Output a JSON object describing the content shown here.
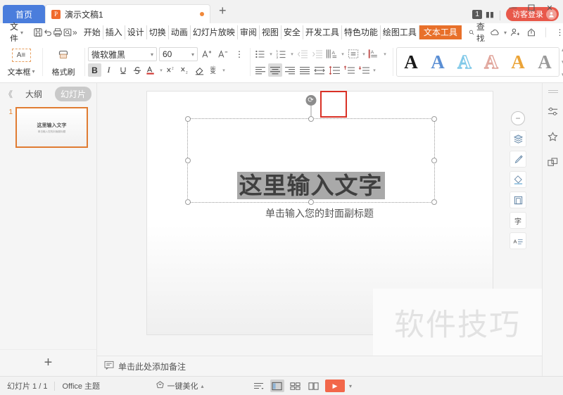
{
  "titlebar": {
    "home_tab": "首页",
    "doc_tab": {
      "icon": "wps-presentation-icon",
      "name": "演示文稿1",
      "modified_dot": "●"
    },
    "new_tab": "+",
    "counter": "1",
    "login_label": "访客登录",
    "window_buttons": {
      "minimize": "—",
      "maximize": "▢",
      "close": "✕"
    }
  },
  "menubar": {
    "file_label": "文件",
    "quick_icons": [
      "save-icon",
      "undo-icon",
      "print-icon",
      "print-preview-icon",
      "more-chevron-icon"
    ],
    "more": "»",
    "tabs": [
      {
        "label": "开始",
        "active": false
      },
      {
        "label": "插入",
        "active": false
      },
      {
        "label": "设计",
        "active": false
      },
      {
        "label": "切换",
        "active": false
      },
      {
        "label": "动画",
        "active": false
      },
      {
        "label": "幻灯片放映",
        "active": false
      },
      {
        "label": "审阅",
        "active": false
      },
      {
        "label": "视图",
        "active": false
      },
      {
        "label": "安全",
        "active": false
      },
      {
        "label": "开发工具",
        "active": false
      },
      {
        "label": "特色功能",
        "active": false
      },
      {
        "label": "绘图工具",
        "active": false
      },
      {
        "label": "文本工具",
        "active": true
      }
    ],
    "find_label": "查找",
    "right_icons": [
      "cloud-icon",
      "add-collaborator-icon",
      "share-icon",
      "more-options-icon",
      "collapse-ribbon-icon"
    ]
  },
  "ribbon": {
    "textbox_label": "文本框",
    "format_painter_label": "格式刷",
    "font_name": "微软雅黑",
    "font_size": "60",
    "grow_font": "A",
    "shrink_font": "A",
    "bold": "B",
    "italic": "I",
    "underline": "U",
    "strikethrough": "S",
    "font_color": "A",
    "superscript": "X",
    "subscript": "X",
    "clear_format": "◇",
    "pinyin": "变",
    "align_active": "center",
    "wordart_styles": [
      {
        "name": "wordart-black",
        "letter": "A",
        "color": "#1a1a1a",
        "style": "solid"
      },
      {
        "name": "wordart-blue",
        "letter": "A",
        "color": "#5b8fd4",
        "style": "solid"
      },
      {
        "name": "wordart-lightblue-outline",
        "letter": "A",
        "color": "#7ec8e8",
        "style": "outline"
      },
      {
        "name": "wordart-pink-outline",
        "letter": "A",
        "color": "#e0a49a",
        "style": "outline"
      },
      {
        "name": "wordart-orange",
        "letter": "A",
        "color": "#eba438",
        "style": "solid"
      },
      {
        "name": "wordart-gray",
        "letter": "A",
        "color": "#9a9a9a",
        "style": "solid"
      }
    ],
    "highlight_box": {
      "name": "align-text-button-highlight",
      "color": "#d93025"
    }
  },
  "leftpanel": {
    "collapse": "《",
    "tab_outline": "大纲",
    "tab_slides": "幻灯片",
    "selected_tab": "幻灯片",
    "slides": [
      {
        "number": "1",
        "title": "这里输入文字",
        "subtitle": "单击输入您的封面副标题"
      }
    ],
    "add_slide": "+"
  },
  "slide": {
    "title_text": "这里输入文字",
    "subtitle_text": "单击输入您的封面副标题",
    "rotate_handle": "⟳",
    "watermark": "软件技巧"
  },
  "floatbar": {
    "collapse": "−",
    "buttons": [
      {
        "name": "layers-icon",
        "glyph": "▤"
      },
      {
        "name": "brush-icon",
        "glyph": "✎"
      },
      {
        "name": "fill-bucket-icon",
        "glyph": "◇"
      },
      {
        "name": "shape-frame-icon",
        "glyph": "▯"
      },
      {
        "name": "text-effects-icon",
        "glyph": "字"
      },
      {
        "name": "text-align-icon",
        "glyph": "A"
      }
    ]
  },
  "rightrail": {
    "icons": [
      {
        "name": "properties-panel-icon"
      },
      {
        "name": "effects-panel-icon"
      },
      {
        "name": "selection-panel-icon"
      }
    ]
  },
  "notes": {
    "placeholder": "单击此处添加备注",
    "icon": "notes-icon"
  },
  "statusbar": {
    "slide_count": "幻灯片 1 / 1",
    "theme": "Office 主题",
    "beautify": "一键美化",
    "view_buttons": [
      {
        "name": "view-options-icon",
        "active": false
      },
      {
        "name": "normal-view-icon",
        "active": true
      },
      {
        "name": "slide-sorter-icon",
        "active": false
      },
      {
        "name": "reading-view-icon",
        "active": false
      }
    ],
    "play_label": "▶"
  }
}
